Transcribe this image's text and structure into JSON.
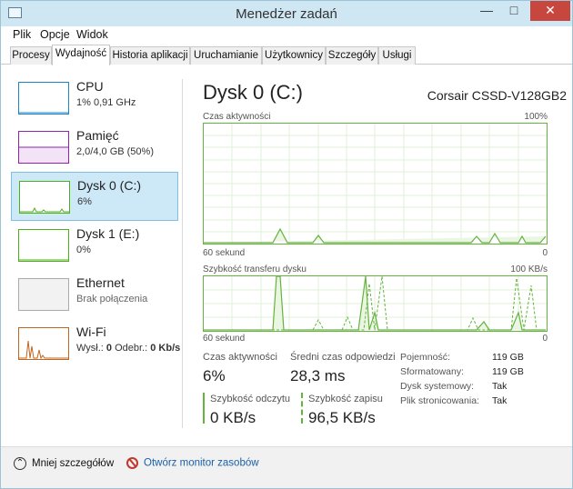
{
  "window": {
    "title": "Menedżer zadań"
  },
  "menu": [
    "Plik",
    "Opcje",
    "Widok"
  ],
  "tabs": [
    "Procesy",
    "Wydajność",
    "Historia aplikacji",
    "Uruchamianie",
    "Użytkownicy",
    "Szczegóły",
    "Usługi"
  ],
  "active_tab": "Wydajność",
  "sidebar": {
    "items": [
      {
        "title": "CPU",
        "sub": "1% 0,91 GHz",
        "color": "#1b86c7"
      },
      {
        "title": "Pamięć",
        "sub": "2,0/4,0 GB (50%)",
        "color": "#8e24aa"
      },
      {
        "title": "Dysk 0 (C:)",
        "sub": "6%",
        "color": "#4caf1b"
      },
      {
        "title": "Dysk 1 (E:)",
        "sub": "0%",
        "color": "#4caf1b"
      },
      {
        "title": "Ethernet",
        "sub": "Brak połączenia",
        "color": "#999999"
      },
      {
        "title": "Wi-Fi",
        "sub_prefix": "Wysł.:",
        "sub_send": "0",
        "sub_mid": "Odebr.:",
        "sub_recv": "0 Kb/s",
        "color": "#c0661f"
      }
    ]
  },
  "main": {
    "disk_title": "Dysk 0 (C:)",
    "disk_model": "Corsair CSSD-V128GB2",
    "graph1": {
      "label": "Czas aktywności",
      "max": "100%",
      "time": "60 sekund",
      "min": "0"
    },
    "graph2": {
      "label": "Szybkość transferu dysku",
      "max": "100 KB/s",
      "time": "60 sekund",
      "min": "0"
    },
    "stats": {
      "active_label": "Czas aktywności",
      "active_value": "6%",
      "response_label": "Średni czas odpowiedzi",
      "response_value": "28,3 ms",
      "read_label": "Szybkość odczytu",
      "read_value": "0 KB/s",
      "write_label": "Szybkość zapisu",
      "write_value": "96,5 KB/s"
    },
    "props": [
      {
        "key": "Pojemność:",
        "val": "119 GB"
      },
      {
        "key": "Sformatowany:",
        "val": "119 GB"
      },
      {
        "key": "Dysk systemowy:",
        "val": "Tak"
      },
      {
        "key": "Plik stronicowania:",
        "val": "Tak"
      }
    ]
  },
  "footer": {
    "less_details": "Mniej szczegółów",
    "resource_monitor": "Otwórz monitor zasobów"
  },
  "colors": {
    "disk_green": "#63b33e",
    "selected_bg": "#cde8f7",
    "link": "#1c5fa6"
  }
}
